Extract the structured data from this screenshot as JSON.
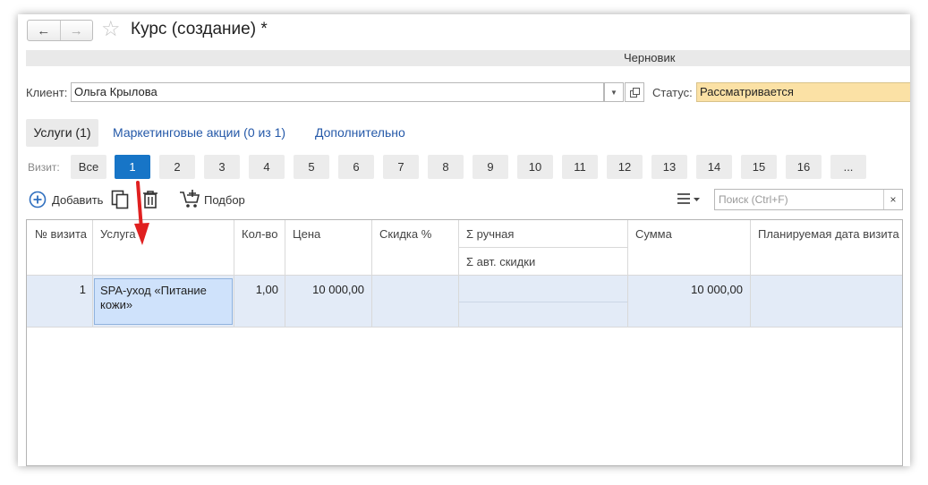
{
  "window": {
    "title": "Курс (создание) *",
    "status_bar": "Черновик"
  },
  "form": {
    "client_label": "Клиент:",
    "client_value": "Ольга Крылова",
    "status_label": "Статус:",
    "status_value": "Рассматривается"
  },
  "tabs": [
    {
      "label": "Услуги (1)",
      "active": true
    },
    {
      "label": "Маркетинговые акции (0 из 1)",
      "active": false
    },
    {
      "label": "Дополнительно",
      "active": false
    }
  ],
  "visits": {
    "label": "Визит:",
    "buttons": [
      "Все",
      "1",
      "2",
      "3",
      "4",
      "5",
      "6",
      "7",
      "8",
      "9",
      "10",
      "11",
      "12",
      "13",
      "14",
      "15",
      "16",
      "..."
    ],
    "active": "1"
  },
  "toolbar": {
    "add_label": "Добавить",
    "pick_label": "Подбор",
    "search_placeholder": "Поиск (Ctrl+F)",
    "clear_label": "×"
  },
  "table": {
    "headers": {
      "visit_no": "№ визита",
      "service": "Услуга",
      "qty": "Кол-во",
      "price": "Цена",
      "discount_pct": "Скидка %",
      "sum_manual": "Σ ручная",
      "sum_auto": "Σ авт. скидки",
      "amount": "Сумма",
      "planned_date": "Планируемая дата визита"
    },
    "rows": [
      {
        "visit_no": "1",
        "service": "SPA-уход «Питание кожи»",
        "qty": "1,00",
        "price": "10 000,00",
        "discount_pct": "",
        "sum_manual": "",
        "sum_auto": "",
        "amount": "10 000,00",
        "planned_date": ""
      }
    ]
  },
  "colors": {
    "accent": "#1775c7",
    "link": "#2458a8",
    "status_field": "#fbe1a5",
    "row_highlight": "#e3ebf7",
    "annotation_arrow": "#e02020"
  }
}
